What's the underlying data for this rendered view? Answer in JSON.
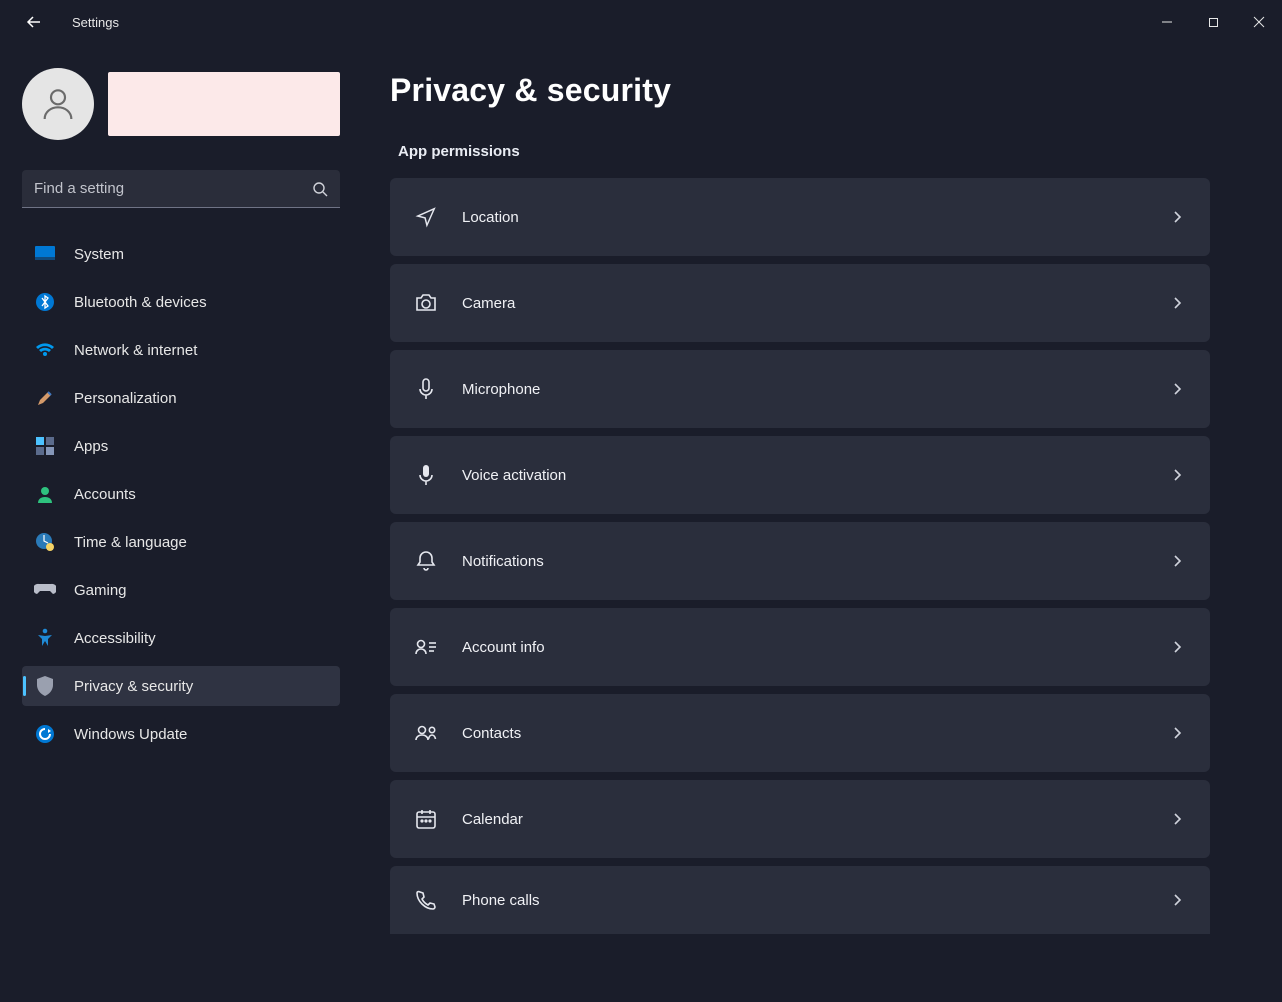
{
  "window": {
    "title": "Settings"
  },
  "sidebar": {
    "search_placeholder": "Find a setting",
    "items": [
      {
        "label": "System"
      },
      {
        "label": "Bluetooth & devices"
      },
      {
        "label": "Network & internet"
      },
      {
        "label": "Personalization"
      },
      {
        "label": "Apps"
      },
      {
        "label": "Accounts"
      },
      {
        "label": "Time & language"
      },
      {
        "label": "Gaming"
      },
      {
        "label": "Accessibility"
      },
      {
        "label": "Privacy & security"
      },
      {
        "label": "Windows Update"
      }
    ]
  },
  "main": {
    "page_title": "Privacy & security",
    "section_title": "App permissions",
    "items": [
      {
        "label": "Location"
      },
      {
        "label": "Camera"
      },
      {
        "label": "Microphone"
      },
      {
        "label": "Voice activation"
      },
      {
        "label": "Notifications"
      },
      {
        "label": "Account info"
      },
      {
        "label": "Contacts"
      },
      {
        "label": "Calendar"
      },
      {
        "label": "Phone calls"
      }
    ]
  }
}
